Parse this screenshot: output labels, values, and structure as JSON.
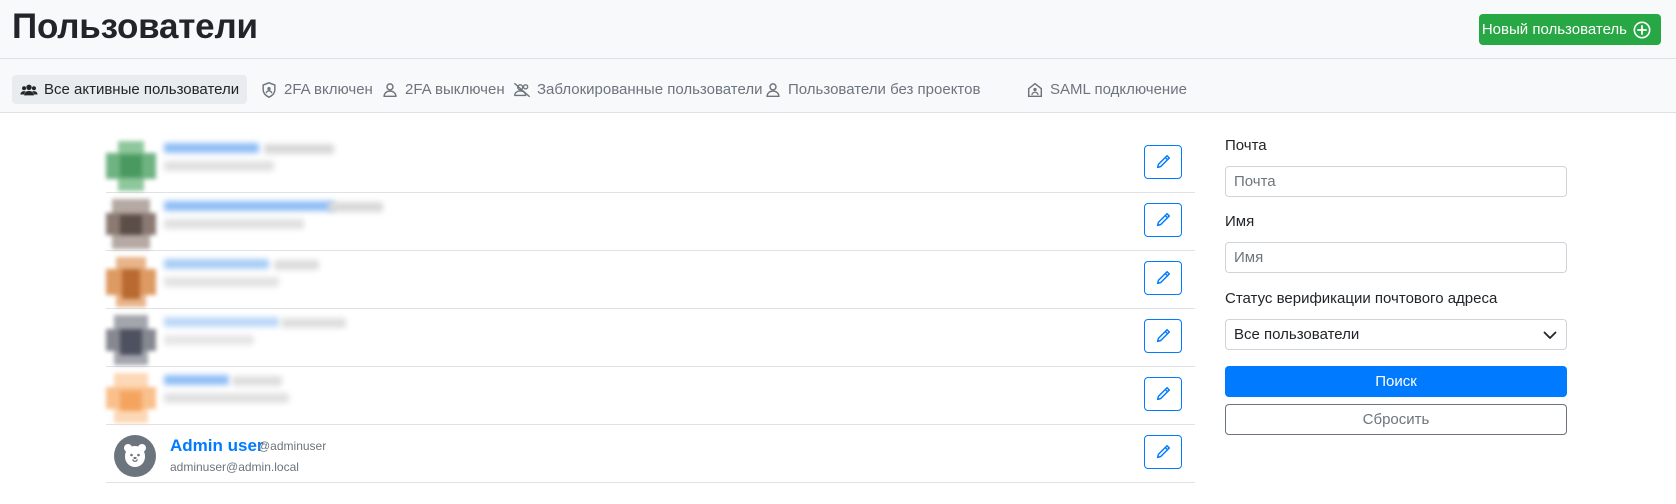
{
  "header": {
    "title": "Пользователи",
    "new_user_label": "Новый пользователь"
  },
  "tabs": [
    {
      "label": "Все активные пользователи",
      "icon": "users-icon",
      "active": true
    },
    {
      "label": "2FA включен",
      "icon": "shield-icon",
      "active": false
    },
    {
      "label": "2FA выключен",
      "icon": "user-icon",
      "active": false
    },
    {
      "label": "Заблокированные пользователи",
      "icon": "users-slash-icon",
      "active": false
    },
    {
      "label": "Пользователи без проектов",
      "icon": "user-icon",
      "active": false
    },
    {
      "label": "SAML подключение",
      "icon": "house-user-icon",
      "active": false
    }
  ],
  "users": [
    {
      "blurred": true,
      "avatar_color": "#5aa56f"
    },
    {
      "blurred": true,
      "avatar_color": "#6b5a52"
    },
    {
      "blurred": true,
      "avatar_color": "#c87a3c"
    },
    {
      "blurred": true,
      "avatar_color": "#5a5d6b"
    },
    {
      "blurred": true,
      "avatar_color": "#f5a460"
    },
    {
      "blurred": false,
      "name": "Admin user",
      "handle": "@adminuser",
      "email": "adminuser@admin.local"
    }
  ],
  "filters": {
    "email_label": "Почта",
    "email_placeholder": "Почта",
    "name_label": "Имя",
    "name_placeholder": "Имя",
    "verification_label": "Статус верификации почтового адреса",
    "verification_value": "Все пользователи",
    "search_label": "Поиск",
    "reset_label": "Сбросить"
  },
  "colors": {
    "primary": "#007bff",
    "success": "#28a745",
    "secondary": "#6c757d"
  }
}
